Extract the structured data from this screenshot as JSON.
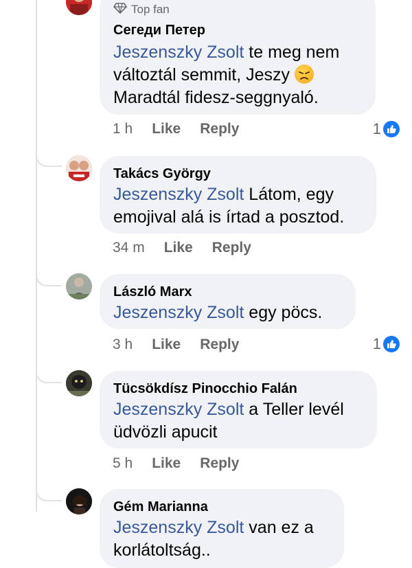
{
  "comments": [
    {
      "badge": "Top fan",
      "author": "Сегеди Петер",
      "mention": "Jeszenszky Zsolt",
      "text_a": " te meg nem változtál semmit, Jeszy ",
      "emoji": "disappointed-face",
      "text_b": " Maradtál fidesz-seggnyaló.",
      "time": "1 h",
      "like": "Like",
      "reply": "Reply",
      "reactions": "1"
    },
    {
      "author": "Takács György",
      "mention": "Jeszenszky Zsolt",
      "text": " Látom, egy emojival alá is írtad a posztod.",
      "time": "34 m",
      "like": "Like",
      "reply": "Reply"
    },
    {
      "author": "László Marx",
      "mention": "Jeszenszky Zsolt",
      "text": " egy pöcs.",
      "time": "3 h",
      "like": "Like",
      "reply": "Reply",
      "reactions": "1"
    },
    {
      "author": "Tücsökdísz Pinocchio Falán",
      "mention": "Jeszenszky Zsolt",
      "text": " a Teller levél üdvözli apucit",
      "time": "5 h",
      "like": "Like",
      "reply": "Reply"
    },
    {
      "author": "Gém Marianna",
      "mention": "Jeszenszky Zsolt",
      "text": " van ez a korlátoltság..",
      "time": "",
      "like": "",
      "reply": ""
    }
  ],
  "colors": {
    "mention": "#385898",
    "bubble": "#f0f2f5",
    "like_badge": "#1877f2"
  }
}
